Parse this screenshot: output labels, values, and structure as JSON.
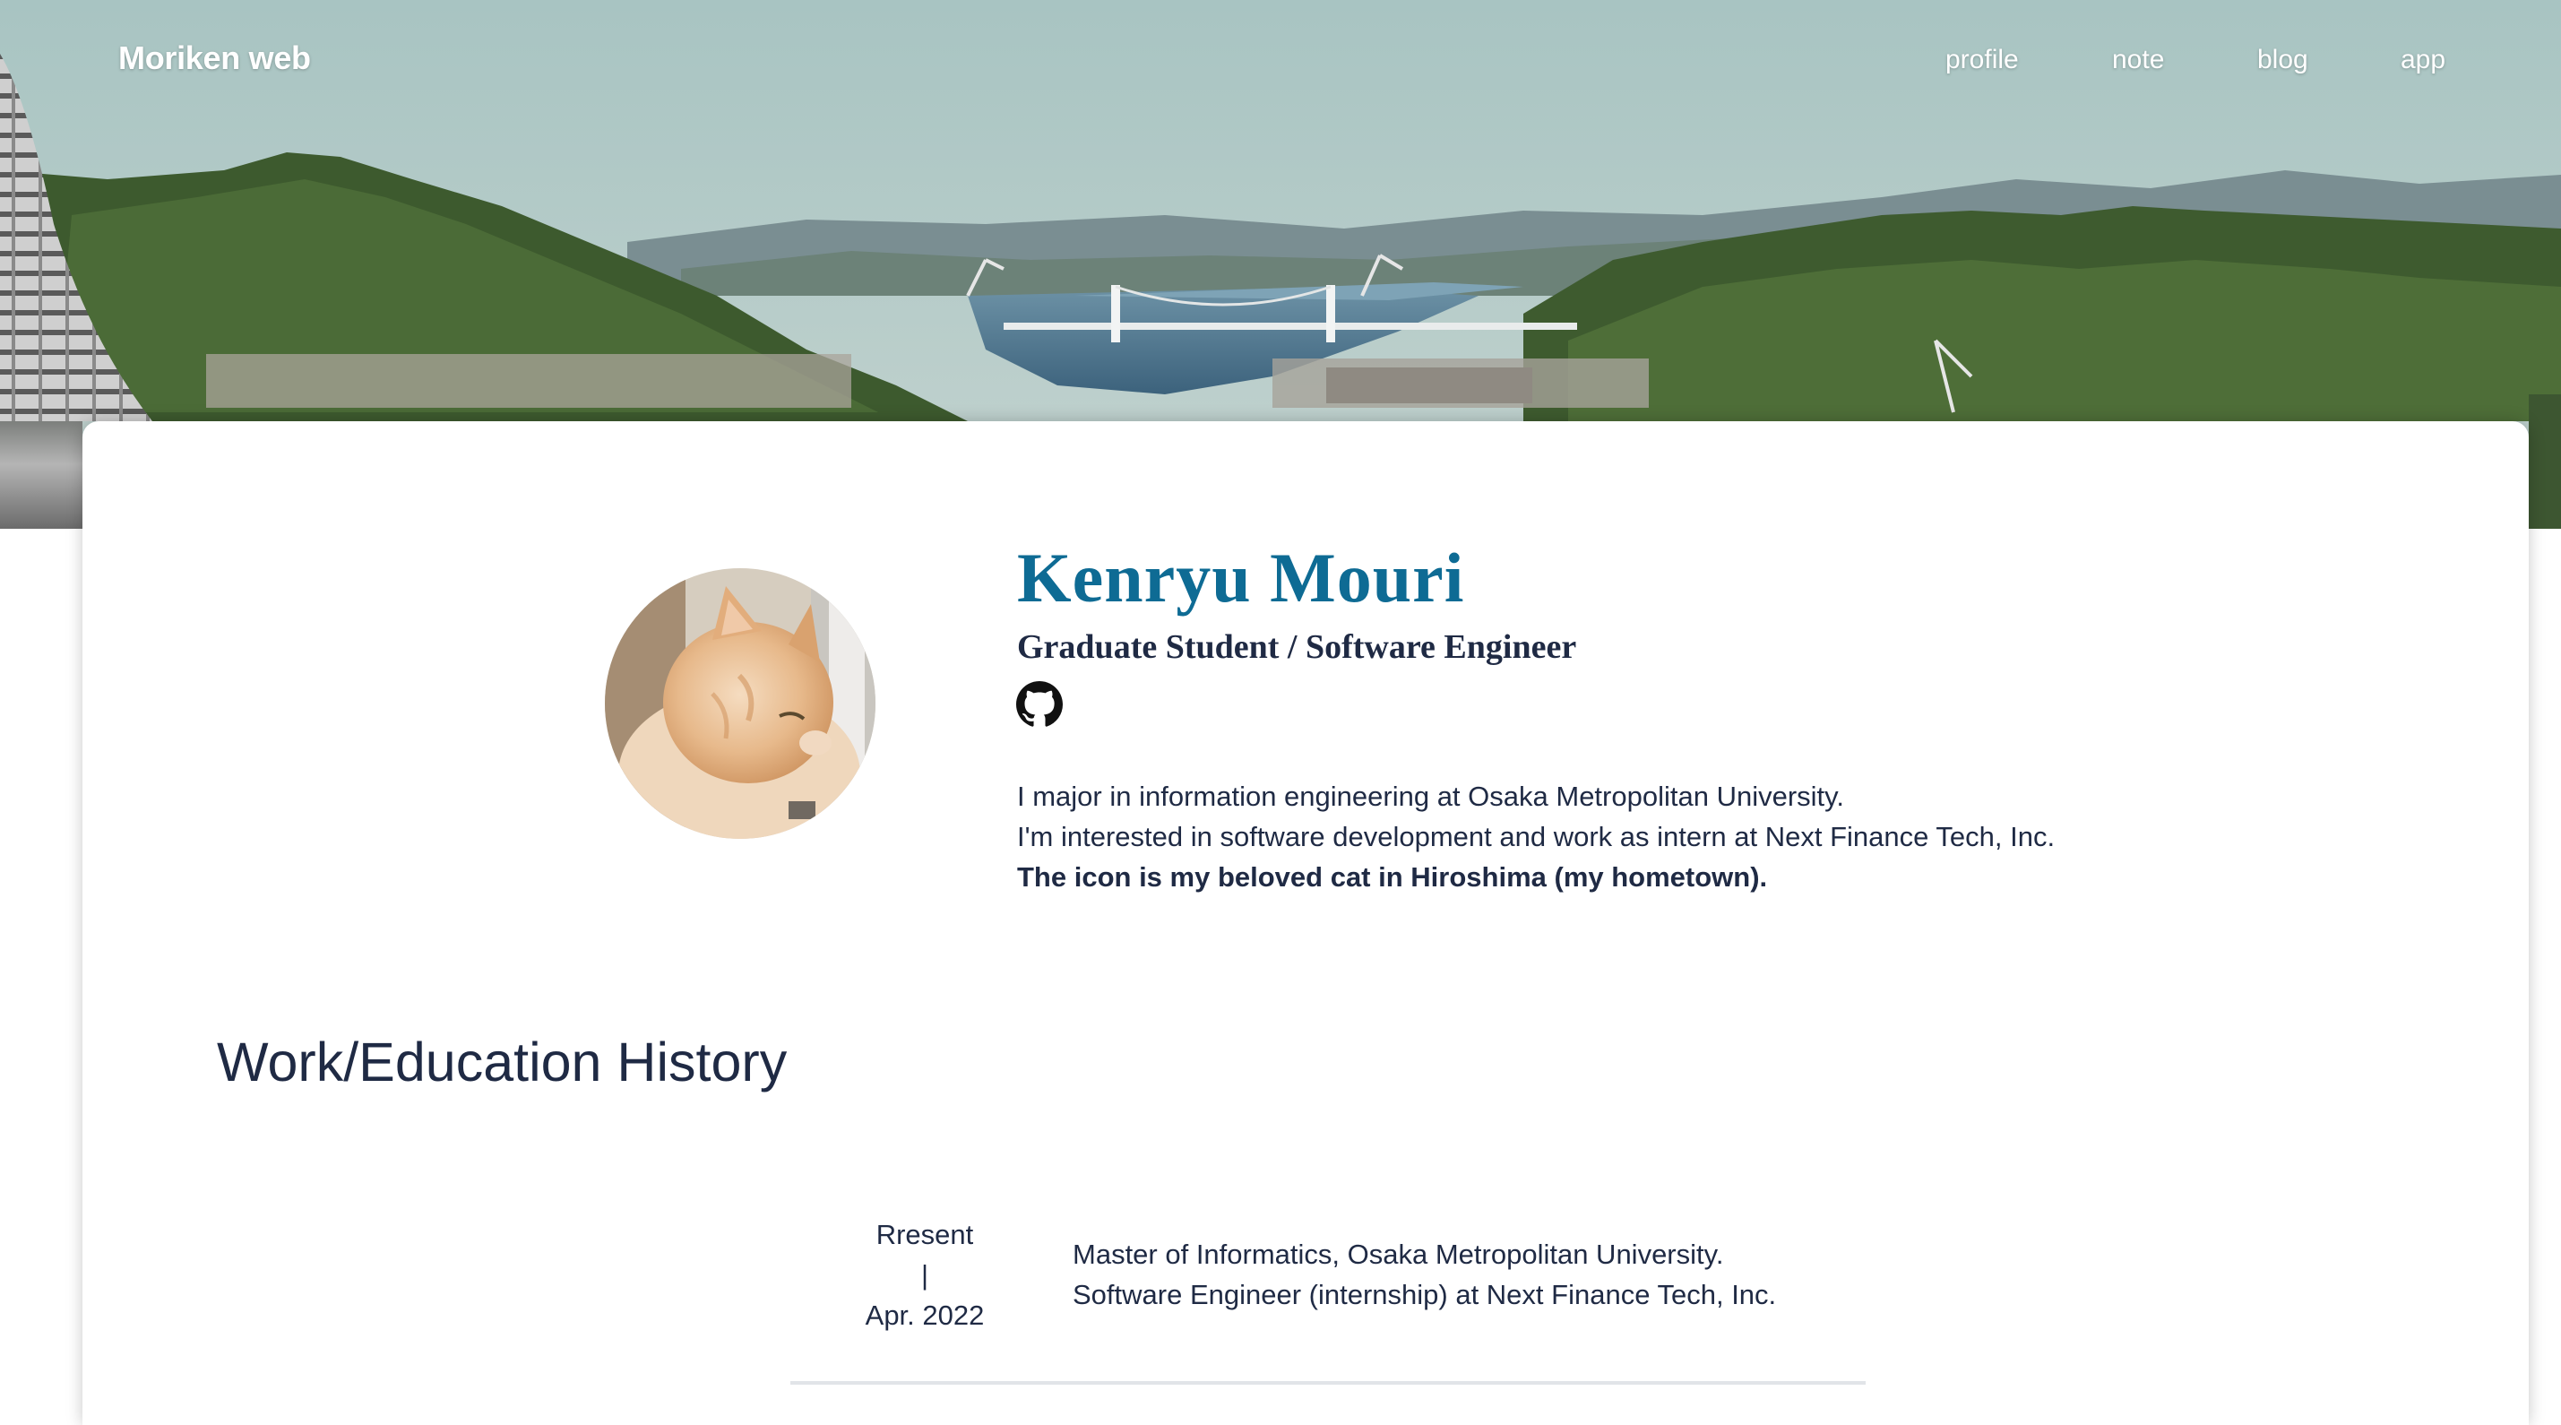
{
  "header": {
    "brand": "Moriken web",
    "nav": [
      "profile",
      "note",
      "blog",
      "app"
    ]
  },
  "profile": {
    "name": "Kenryu Mouri",
    "role": "Graduate Student / Software Engineer",
    "github_icon": "github-icon",
    "avatar_icon": "cat-photo",
    "bio": [
      "I major in information engineering at Osaka Metropolitan University.",
      "I'm interested in software development and work as intern at Next Finance Tech, Inc.",
      "The icon is my beloved cat in Hiroshima (my hometown)."
    ]
  },
  "history": {
    "title": "Work/Education History",
    "entries": [
      {
        "date_end": "Rresent",
        "separator": "|",
        "date_start": "Apr. 2022",
        "lines": [
          "Master of Informatics, Osaka Metropolitan University.",
          "Software Engineer (internship) at Next Finance Tech, Inc."
        ]
      }
    ]
  },
  "colors": {
    "name": "#0e6b94",
    "text": "#1f2a44",
    "nav_text": "#ffffff"
  }
}
